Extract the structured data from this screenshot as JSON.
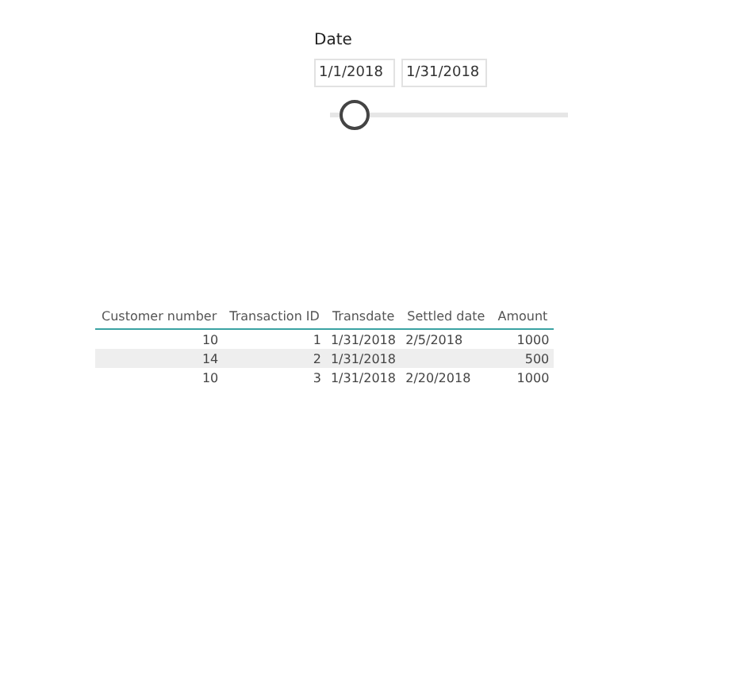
{
  "date_slicer": {
    "title": "Date",
    "start": "1/1/2018",
    "end": "1/31/2018",
    "level": 0.1
  },
  "table": {
    "columns": [
      {
        "label": "Customer number",
        "kind": "number"
      },
      {
        "label": "Transaction ID",
        "kind": "number"
      },
      {
        "label": "Transdate",
        "kind": "date"
      },
      {
        "label": "Settled date",
        "kind": "date"
      },
      {
        "label": "Amount",
        "kind": "number"
      }
    ],
    "rows": [
      [
        "10",
        "1",
        "1/31/2018",
        "2/5/2018",
        "1000"
      ],
      [
        "14",
        "2",
        "1/31/2018",
        "",
        "500"
      ],
      [
        "10",
        "3",
        "1/31/2018",
        "2/20/2018",
        "1000"
      ]
    ]
  }
}
